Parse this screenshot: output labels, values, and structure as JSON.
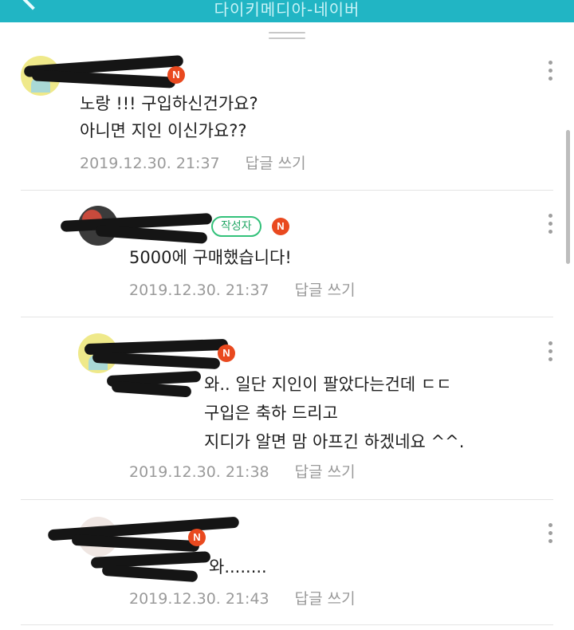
{
  "header": {
    "title": "다이키메디아-네이버"
  },
  "comments": [
    {
      "text": "노랑 !!! 구입하신건가요?\n아니면 지인 이신가요??",
      "date": "2019.12.30. 21:37",
      "reply_label": "답글 쓰기",
      "badge": "N"
    },
    {
      "text": "5000에 구매했습니다!",
      "date": "2019.12.30. 21:37",
      "reply_label": "답글 쓰기",
      "author_badge": "작성자",
      "badge": "N"
    },
    {
      "text": "와.. 일단 지인이 팔았다는건데 ㄷㄷ\n구입은 축하 드리고\n지디가 알면 맘 아프긴 하겠네요 ^^.",
      "date": "2019.12.30. 21:38",
      "reply_label": "답글 쓰기",
      "badge": "N"
    },
    {
      "text": "와........",
      "date": "2019.12.30. 21:43",
      "reply_label": "답글 쓰기",
      "badge": "N"
    }
  ],
  "icons": {
    "back": "back-arrow-icon",
    "more": "more-vertical-icon",
    "new_badge": "new-badge-icon"
  },
  "colors": {
    "topbar": "#21b5c4",
    "new_badge": "#e9491f",
    "author_badge": "#33c17a",
    "meta_text": "#9a9a9a"
  }
}
